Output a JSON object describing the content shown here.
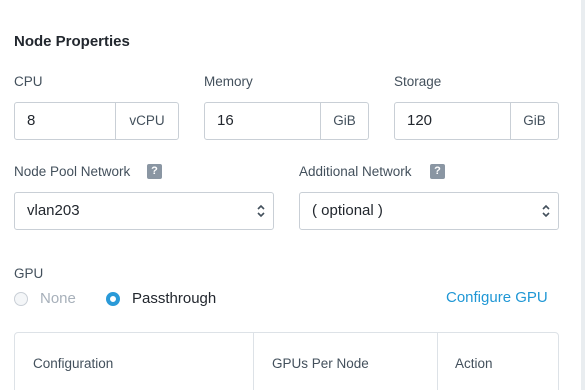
{
  "section": {
    "title": "Node Properties"
  },
  "cpu": {
    "label": "CPU",
    "value": "8",
    "unit": "vCPU"
  },
  "memory": {
    "label": "Memory",
    "value": "16",
    "unit": "GiB"
  },
  "storage": {
    "label": "Storage",
    "value": "120",
    "unit": "GiB"
  },
  "node_pool_network": {
    "label": "Node Pool Network",
    "help": "?",
    "value": "vlan203"
  },
  "additional_network": {
    "label": "Additional Network",
    "help": "?",
    "value": "( optional )"
  },
  "gpu": {
    "label": "GPU",
    "options": [
      {
        "label": "None",
        "selected": false
      },
      {
        "label": "Passthrough",
        "selected": true
      }
    ],
    "configure_link": "Configure GPU"
  },
  "table": {
    "columns": [
      "Configuration",
      "GPUs Per Node",
      "Action"
    ]
  },
  "colors": {
    "accent": "#1f97d5",
    "border": "#c9cfd6",
    "text": "#22272e",
    "muted": "#43505c",
    "disabled": "#a7b0ba"
  }
}
